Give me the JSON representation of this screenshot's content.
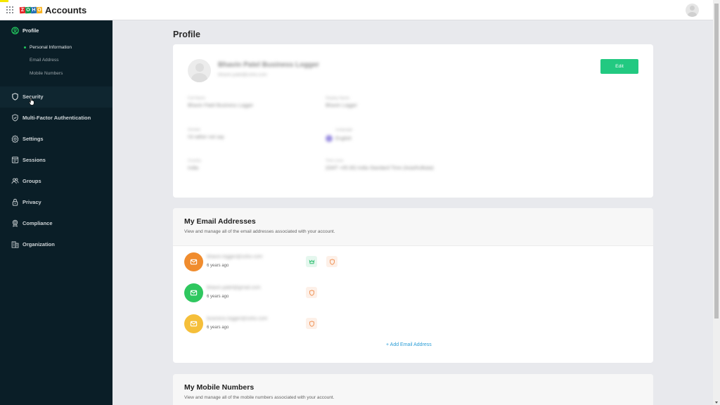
{
  "header": {
    "app_title": "Accounts",
    "logo_letters": [
      "Z",
      "O",
      "H",
      "O"
    ],
    "logo_colors": [
      "#e42527",
      "#089949",
      "#226db4",
      "#f9b21d"
    ],
    "apps_icon": "grid-icon",
    "user_avatar": "user-avatar-icon"
  },
  "sidebar": {
    "profile": {
      "label": "Profile",
      "icon": "user-circle-icon",
      "accent": "#22c55e",
      "sub_items": [
        {
          "label": "Personal Information",
          "active": true
        },
        {
          "label": "Email Address",
          "active": false
        },
        {
          "label": "Mobile Numbers",
          "active": false
        }
      ]
    },
    "items": [
      {
        "label": "Security",
        "icon": "shield-icon"
      },
      {
        "label": "Multi-Factor Authentication",
        "icon": "shield-check-icon"
      },
      {
        "label": "Settings",
        "icon": "gear-icon"
      },
      {
        "label": "Sessions",
        "icon": "sessions-icon"
      },
      {
        "label": "Groups",
        "icon": "users-icon"
      },
      {
        "label": "Privacy",
        "icon": "lock-icon"
      },
      {
        "label": "Compliance",
        "icon": "award-icon"
      },
      {
        "label": "Organization",
        "icon": "building-icon"
      }
    ]
  },
  "main": {
    "page_title": "Profile",
    "profile_card": {
      "name": "Bhavin Patel Business Logger",
      "subtitle": "bhavin.patel@zoho.com",
      "edit_label": "Edit",
      "edit_color": "#22c981",
      "fields": [
        {
          "label": "Full Name",
          "value": "Bhavin Patel Business Logger"
        },
        {
          "label": "Display Name",
          "value": "Bhavin Logger"
        },
        {
          "label": "Gender",
          "value": "I'd rather not say"
        },
        {
          "label": "Language",
          "value": "English"
        },
        {
          "label": "Country",
          "value": "India"
        },
        {
          "label": "Time zone",
          "value": "(GMT +05:30) India Standard Time (Asia/Kolkata)"
        }
      ]
    },
    "email_card": {
      "title": "My Email Addresses",
      "description": "View and manage all of the email addresses associated with your account.",
      "emails": [
        {
          "address": "bhavin.logger@zoho.com",
          "time": "6 years ago",
          "color": "#f08c2e",
          "primary": true,
          "secure": true
        },
        {
          "address": "bhavin.patel@gmail.com",
          "time": "6 years ago",
          "color": "#2fc75f",
          "primary": false,
          "secure": true
        },
        {
          "address": "business.logger@zoho.com",
          "time": "6 years ago",
          "color": "#f5bf3a",
          "primary": false,
          "secure": true
        }
      ],
      "add_label": "+ Add Email Address",
      "link_color": "#2a9dd6"
    },
    "mobile_card": {
      "title": "My Mobile Numbers",
      "description": "View and manage all of the mobile numbers associated with your account."
    }
  }
}
